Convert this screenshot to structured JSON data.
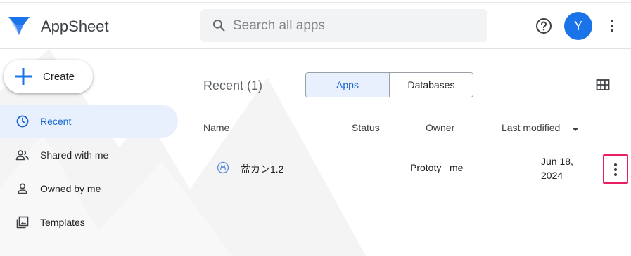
{
  "app": {
    "name": "AppSheet"
  },
  "search": {
    "placeholder": "Search all apps"
  },
  "header": {
    "avatar_initial": "Y",
    "help_icon": "help-circle-icon",
    "menu_icon": "more-vert-icon"
  },
  "create": {
    "label": "Create"
  },
  "nav": {
    "items": [
      {
        "label": "Recent",
        "icon": "clock-icon",
        "active": true
      },
      {
        "label": "Shared with me",
        "icon": "people-icon",
        "active": false
      },
      {
        "label": "Owned by me",
        "icon": "person-icon",
        "active": false
      },
      {
        "label": "Templates",
        "icon": "templates-icon",
        "active": false
      }
    ]
  },
  "main": {
    "title": "Recent (1)",
    "tabs": [
      {
        "label": "Apps",
        "selected": true
      },
      {
        "label": "Databases",
        "selected": false
      }
    ],
    "columns": {
      "name": "Name",
      "status": "Status",
      "owner": "Owner",
      "modified": "Last modified"
    },
    "rows": [
      {
        "name": "盆カン1.2",
        "status": "Prototype",
        "owner": "me",
        "modified": "Jun 18, 2024"
      }
    ]
  },
  "colors": {
    "accent": "#1a73e8",
    "active_bg": "#e8f0fe",
    "highlight": "#e91e63"
  }
}
